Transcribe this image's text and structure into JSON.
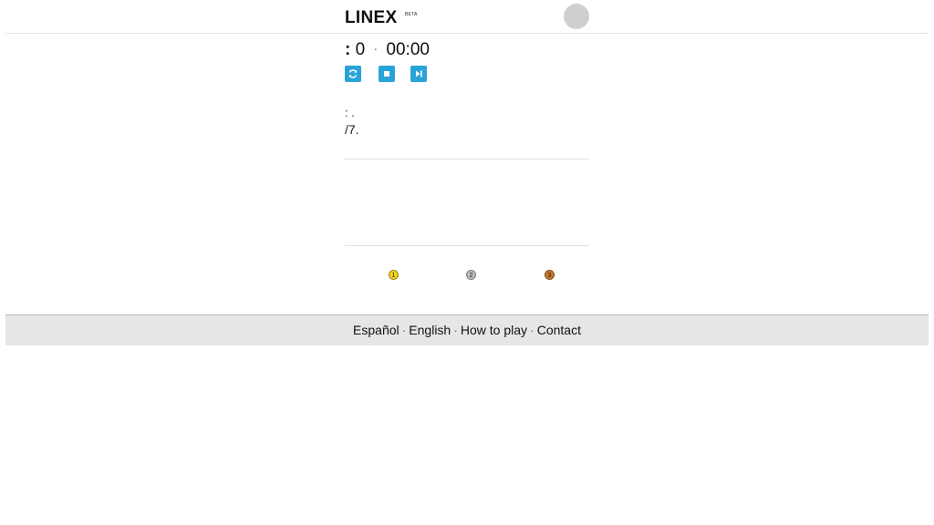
{
  "header": {
    "logo": "LINEX",
    "badge": "BETA",
    "avatar_color": "#cfcfcf"
  },
  "status": {
    "colon": ":",
    "count": "0",
    "separator": "·",
    "time": "00:00"
  },
  "controls": {
    "accent": "#2aa3d8",
    "icons": [
      "refresh-icon",
      "stop-icon",
      "skip-icon"
    ]
  },
  "info": {
    "line1": ": .",
    "line2": "/7."
  },
  "medals": [
    {
      "label": "1",
      "color": "#f2d21b"
    },
    {
      "label": "2",
      "color": "#bdbdbd"
    },
    {
      "label": "3",
      "color": "#c57a2a"
    }
  ],
  "footer": {
    "links": [
      "Español",
      "English",
      "How to play",
      "Contact"
    ],
    "separator": "·"
  }
}
